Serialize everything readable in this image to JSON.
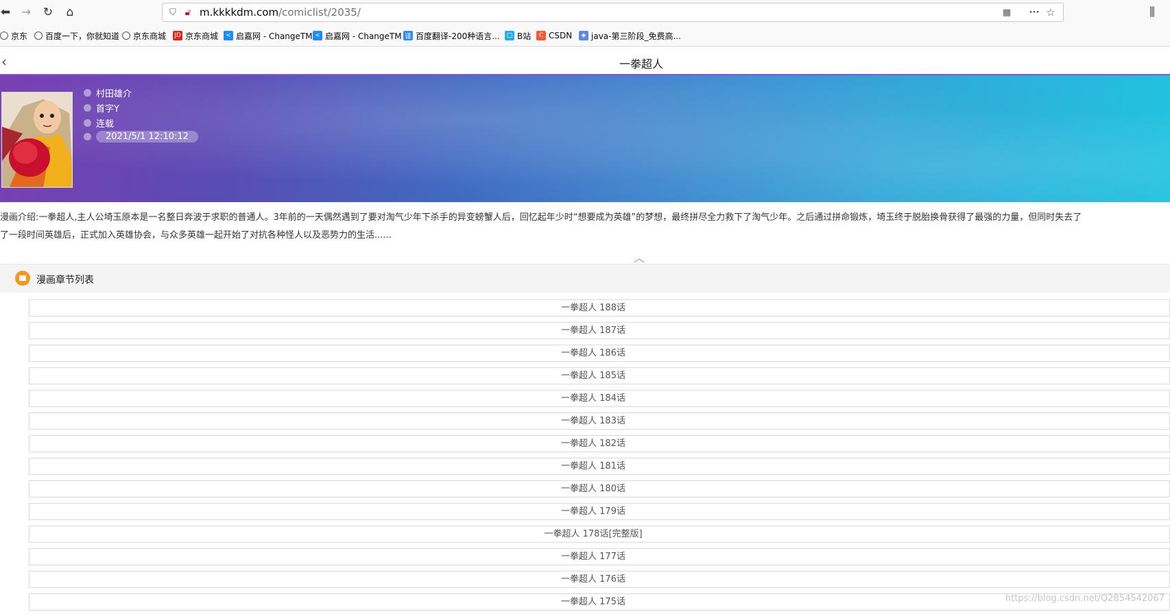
{
  "browser": {
    "url_host": "m.kkkkdm.com",
    "url_path": "/comiclist/2035/"
  },
  "bookmarks": [
    {
      "label": "京东",
      "icon": "globe-icon"
    },
    {
      "label": "百度一下，你就知道",
      "icon": "globe-icon"
    },
    {
      "label": "京东商城",
      "icon": "globe-icon"
    },
    {
      "label": "京东商城",
      "icon": "jd-icon",
      "icon_text": "JD",
      "color": "#e1251b"
    },
    {
      "label": "启嘉网 - ChangeTM",
      "icon": "changetm-icon",
      "icon_text": "<",
      "color": "#1a8cff"
    },
    {
      "label": "启嘉网 - ChangeTM",
      "icon": "changetm-icon",
      "icon_text": "<",
      "color": "#1a8cff"
    },
    {
      "label": "百度翻译-200种语言...",
      "icon": "baidu-translate-icon",
      "icon_text": "译",
      "color": "#2f8cff"
    },
    {
      "label": "B站",
      "icon": "bilibili-icon",
      "icon_text": "▢",
      "color": "#23ade5"
    },
    {
      "label": "CSDN",
      "icon": "csdn-icon",
      "icon_text": "C",
      "color": "#fc5531"
    },
    {
      "label": "java-第三阶段_免费高...",
      "icon": "java-icon",
      "icon_text": "◈",
      "color": "#5b8ad6"
    }
  ],
  "header": {
    "title": "一拳超人"
  },
  "comic": {
    "author": "村田雄介",
    "initial": "首字Y",
    "status": "连载",
    "updated": "2021/5/1 12:10:12",
    "intro_line1": "漫画介绍:一拳超人,主人公埼玉原本是一名整日奔波于求职的普通人。3年前的一天偶然遇到了要对淘气少年下杀手的异变螃蟹人后，回忆起年少时“想要成为英雄”的梦想，最终拼尽全力救下了淘气少年。之后通过拼命锻炼，埼玉终于脱胎换骨获得了最强的力量，但同时失去了",
    "intro_line2": "了一段时间英雄后，正式加入英雄协会，与众多英雄一起开始了对抗各种怪人以及恶势力的生活......"
  },
  "chapter_list": {
    "title": "漫画章节列表",
    "chapters": [
      "一拳超人 188话",
      "一拳超人 187话",
      "一拳超人 186话",
      "一拳超人 185话",
      "一拳超人 184话",
      "一拳超人 183话",
      "一拳超人 182话",
      "一拳超人 181话",
      "一拳超人 180话",
      "一拳超人 179话",
      "一拳超人 178话[完整版]",
      "一拳超人 177话",
      "一拳超人 176话",
      "一拳超人 175话"
    ]
  },
  "watermark": "https://blog.csdn.net/Q2854542067"
}
